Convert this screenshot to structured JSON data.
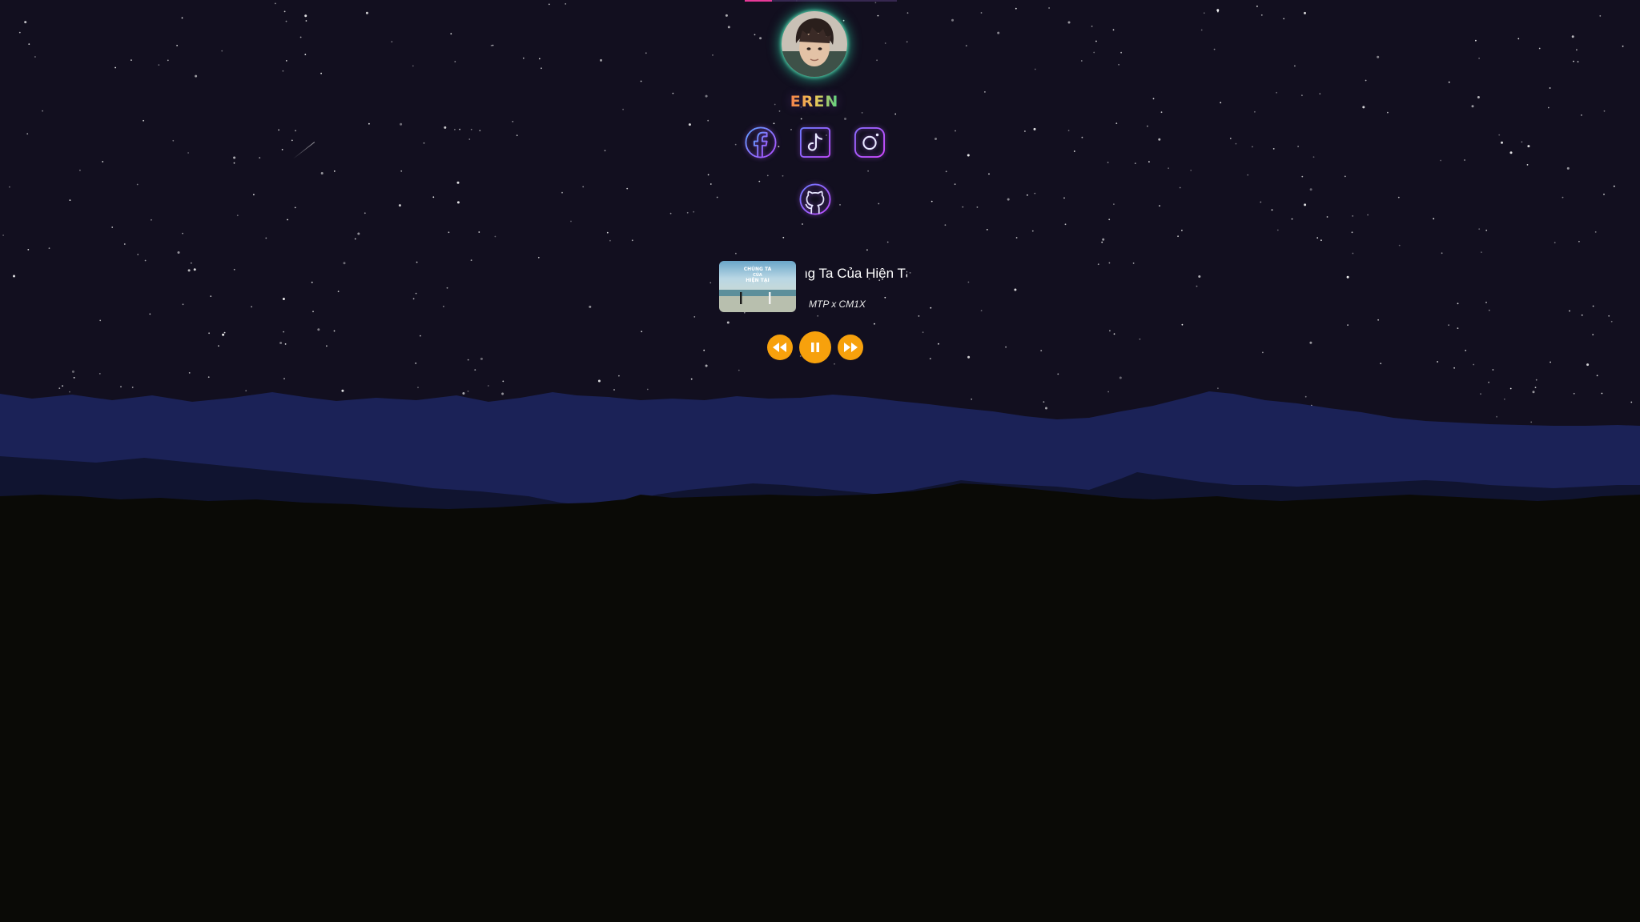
{
  "profile": {
    "name": "EREN",
    "avatar_icon": "avatar-photo"
  },
  "socials": [
    {
      "id": "facebook",
      "icon": "facebook-icon"
    },
    {
      "id": "tiktok",
      "icon": "tiktok-icon"
    },
    {
      "id": "instagram",
      "icon": "instagram-icon"
    },
    {
      "id": "github",
      "icon": "github-icon"
    }
  ],
  "player": {
    "track_title": "Chúng Ta Của Hiện Tại- lofi   Chúng Ta",
    "artist": "MTP x CM1X",
    "cover_text_line1": "CHÚNG TA",
    "cover_text_line2": "CỦA",
    "cover_text_line3": "HIỆN TẠI",
    "controls": {
      "prev_icon": "rewind-icon",
      "play_pause_icon": "pause-icon",
      "next_icon": "fast-forward-icon"
    }
  },
  "colors": {
    "sky": "#120f1f",
    "mountain_far": "#1b2257",
    "mountain_mid": "#101430",
    "ground": "#0a0a06",
    "control_accent": "#f7a10c",
    "avatar_glow": "#2edcaa",
    "icon_outline": "#a35cff"
  }
}
